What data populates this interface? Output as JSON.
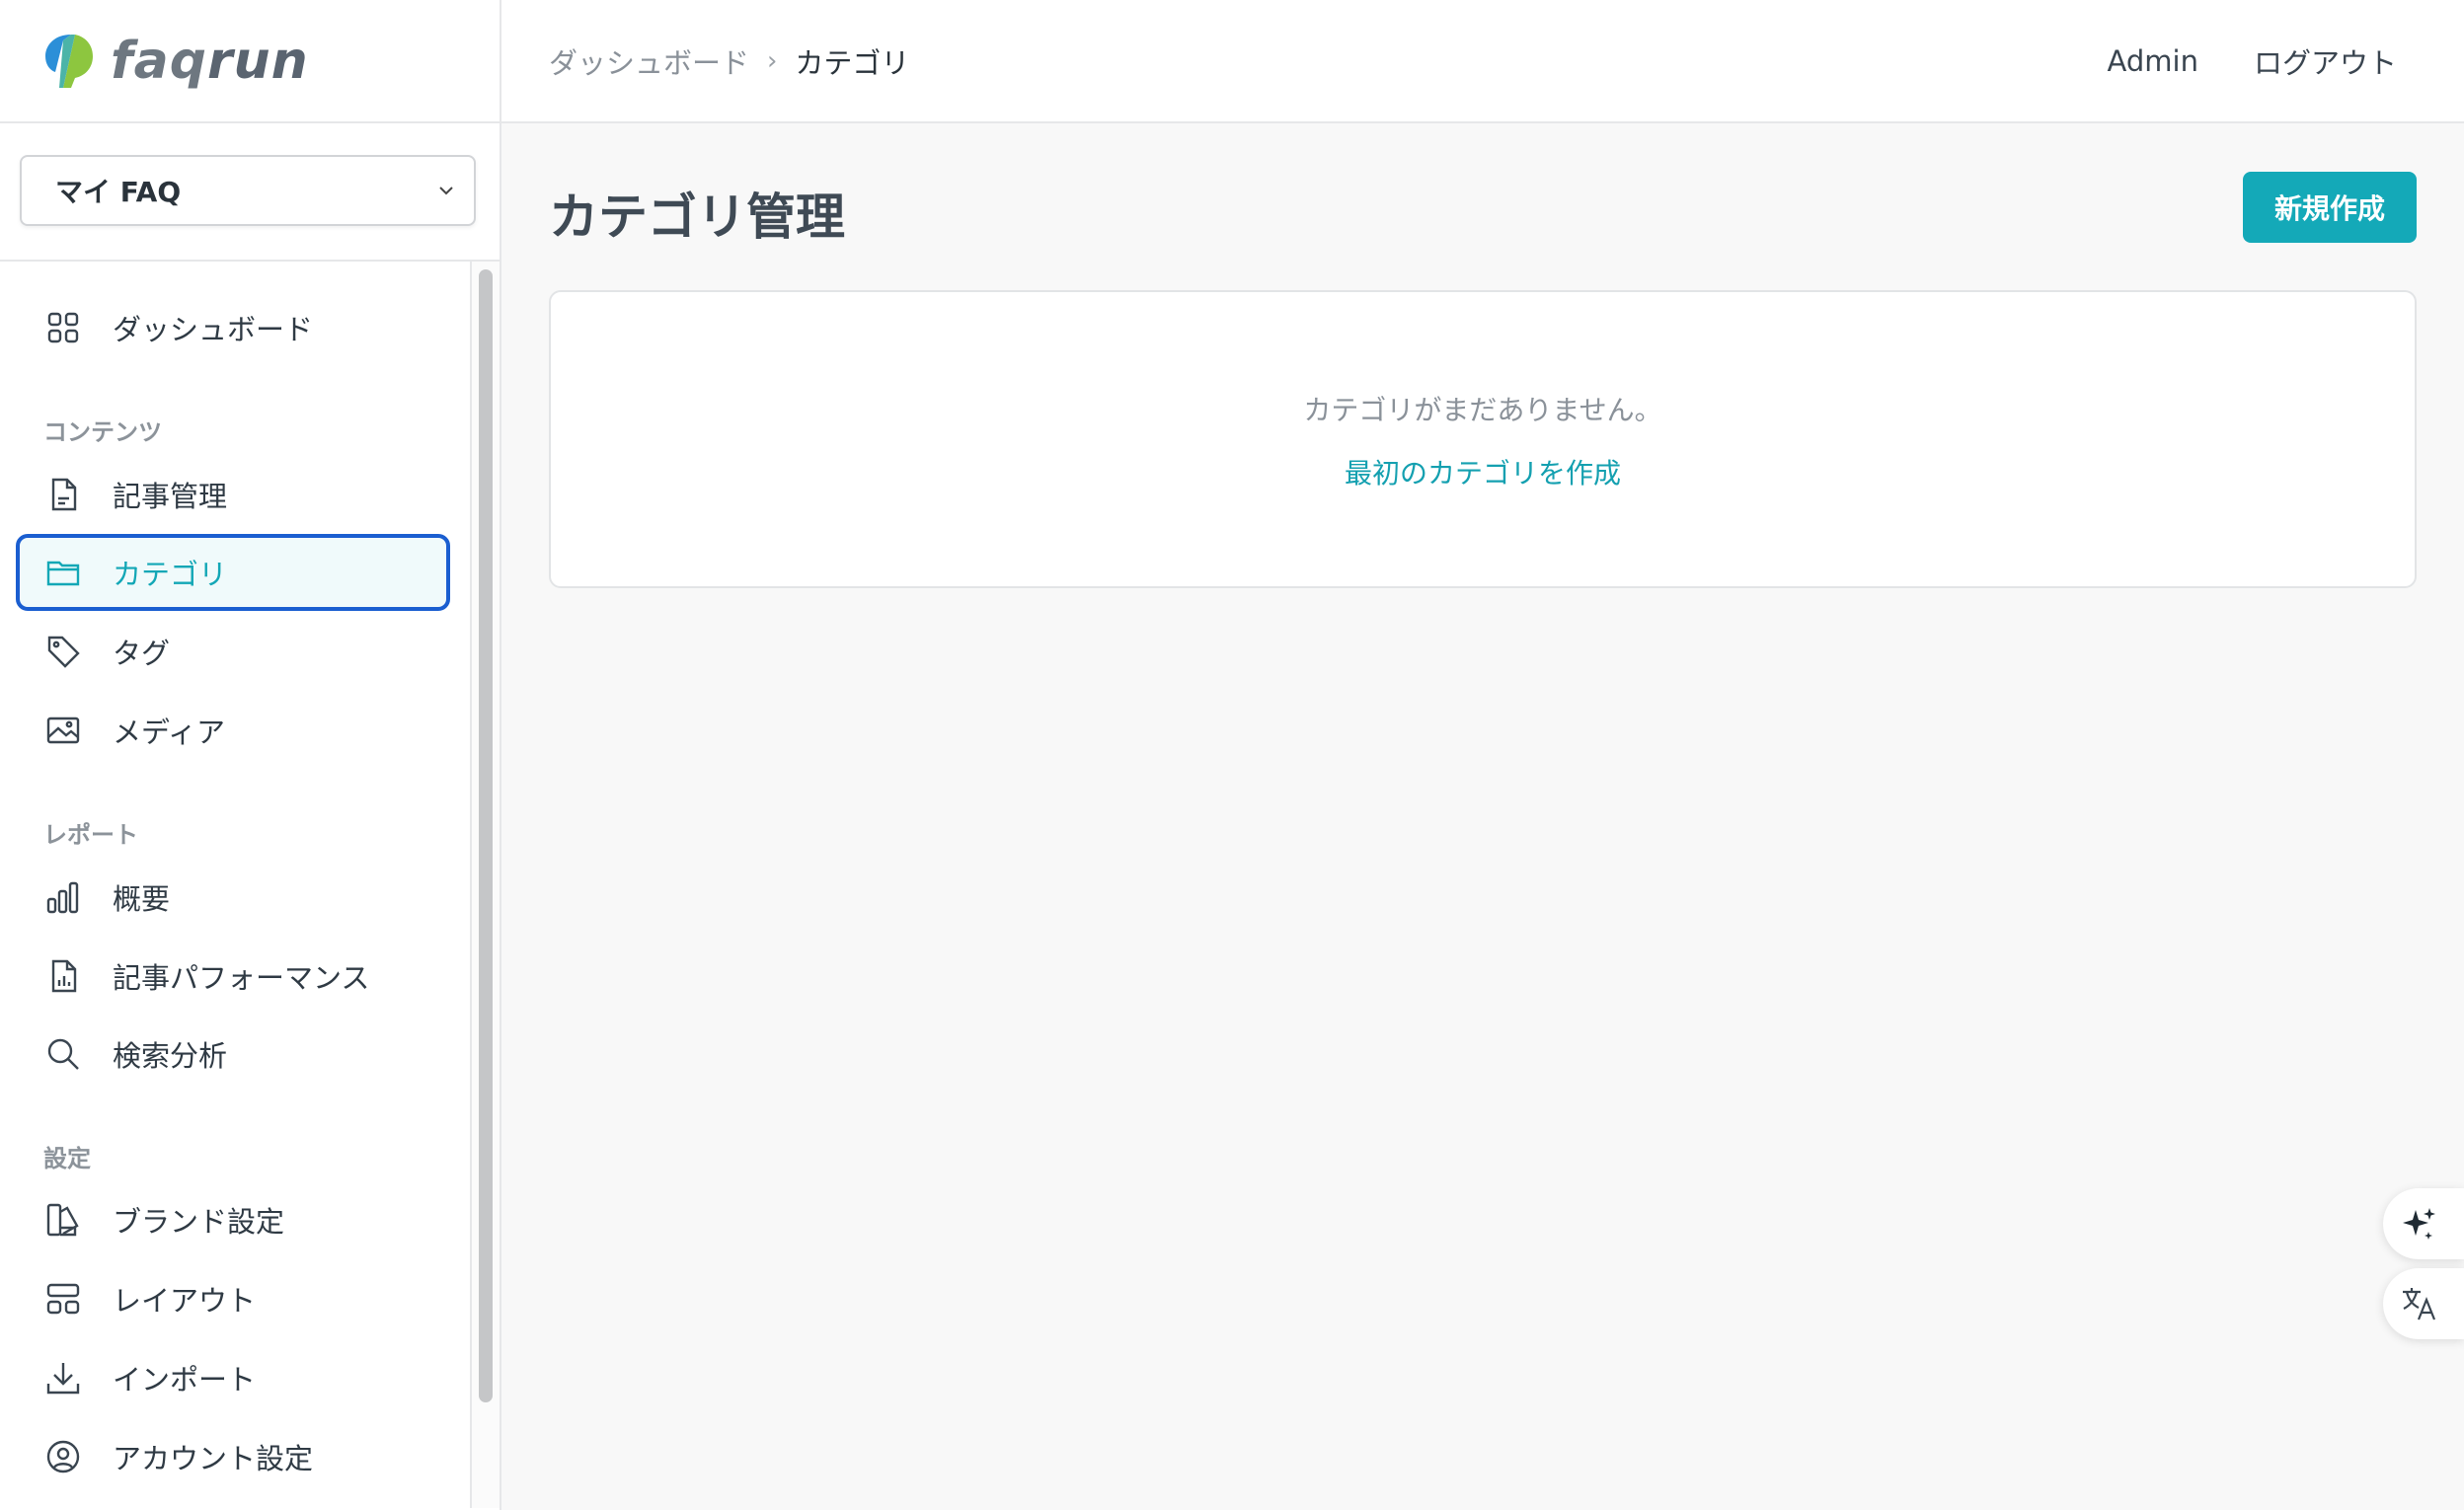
{
  "brand": {
    "name_f": "fa",
    "name_q": "q",
    "name_run": "run",
    "accent": "#14a9b8",
    "logo_blue": "#2b8fd8",
    "logo_green": "#8dc63f"
  },
  "faq_selector": {
    "selected": "マイ FAQ"
  },
  "sidebar": {
    "dashboard": {
      "label": "ダッシュボード",
      "icon": "grid-icon"
    },
    "sections": {
      "content": "コンテンツ",
      "reports": "レポート",
      "settings": "設定"
    },
    "content_items": [
      {
        "label": "記事管理",
        "icon": "document-icon"
      },
      {
        "label": "カテゴリ",
        "icon": "folder-icon",
        "active": true
      },
      {
        "label": "タグ",
        "icon": "tag-icon"
      },
      {
        "label": "メディア",
        "icon": "image-icon"
      }
    ],
    "report_items": [
      {
        "label": "概要",
        "icon": "bar-chart-icon"
      },
      {
        "label": "記事パフォーマンス",
        "icon": "document-chart-icon"
      },
      {
        "label": "検索分析",
        "icon": "search-icon"
      }
    ],
    "settings_items": [
      {
        "label": "ブランド設定",
        "icon": "palette-icon"
      },
      {
        "label": "レイアウト",
        "icon": "layout-icon"
      },
      {
        "label": "インポート",
        "icon": "download-icon"
      },
      {
        "label": "アカウント設定",
        "icon": "user-circle-icon"
      }
    ]
  },
  "header": {
    "breadcrumb": {
      "parent": "ダッシュボード",
      "separator": "›",
      "current": "カテゴリ"
    },
    "user": "Admin",
    "logout": "ログアウト"
  },
  "main": {
    "title": "カテゴリ管理",
    "new_button": "新規作成",
    "empty_message": "カテゴリがまだありません。",
    "empty_action": "最初のカテゴリを作成"
  },
  "floating": [
    {
      "icon": "sparkle-icon"
    },
    {
      "icon": "translate-icon"
    }
  ]
}
